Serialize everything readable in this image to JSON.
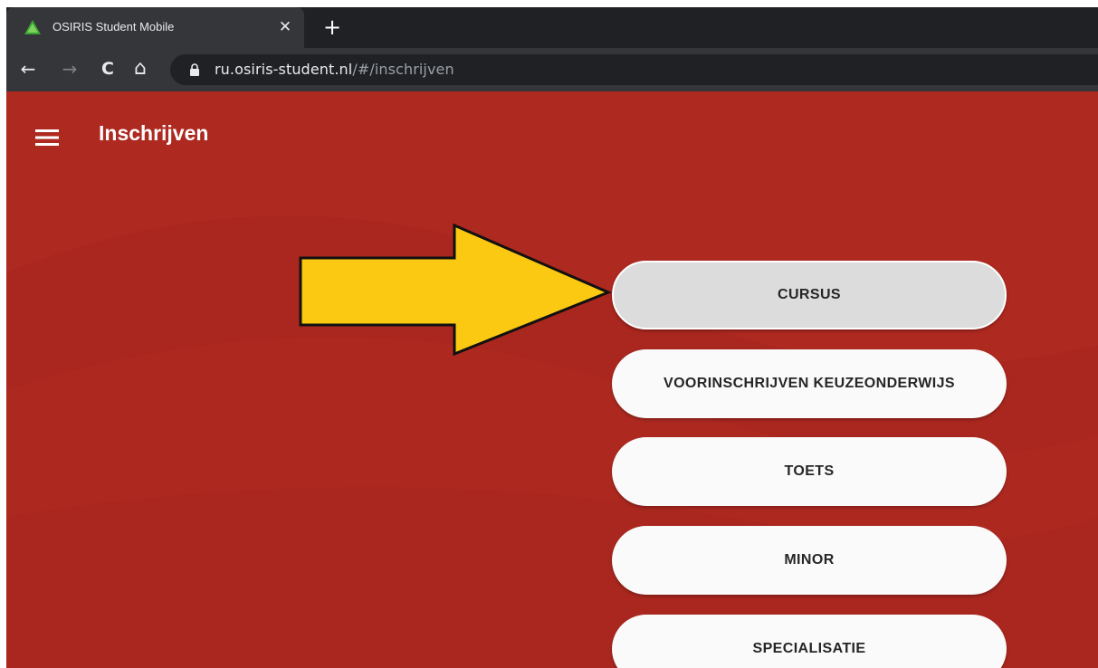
{
  "browser": {
    "tab": {
      "title": "OSIRIS Student Mobile",
      "favicon": "green-tree-icon",
      "close_glyph": "✕"
    },
    "new_tab_glyph": "+",
    "toolbar": {
      "back": "←",
      "forward": "→",
      "reload": "C",
      "home": "⌂"
    },
    "address": {
      "host": "ru.osiris-student.nl",
      "path": "/#/inschrijven",
      "secure_icon": "lock-icon"
    }
  },
  "app": {
    "menu_icon": "hamburger-menu-icon",
    "title": "Inschrijven",
    "options": [
      {
        "label": "CURSUS",
        "selected": true
      },
      {
        "label": "VOORINSCHRIJVEN KEUZEONDERWIJS",
        "selected": false
      },
      {
        "label": "TOETS",
        "selected": false
      },
      {
        "label": "MINOR",
        "selected": false
      },
      {
        "label": "SPECIALISATIE",
        "selected": false
      }
    ],
    "annotation": {
      "type": "arrow",
      "color": "#fcc912",
      "points_to": "CURSUS"
    }
  },
  "colors": {
    "header_bg": "#ae2920",
    "tab_strip": "#202124",
    "toolbar": "#35363a",
    "button_bg": "#fafafa",
    "button_selected_bg": "#dcdcdc"
  }
}
